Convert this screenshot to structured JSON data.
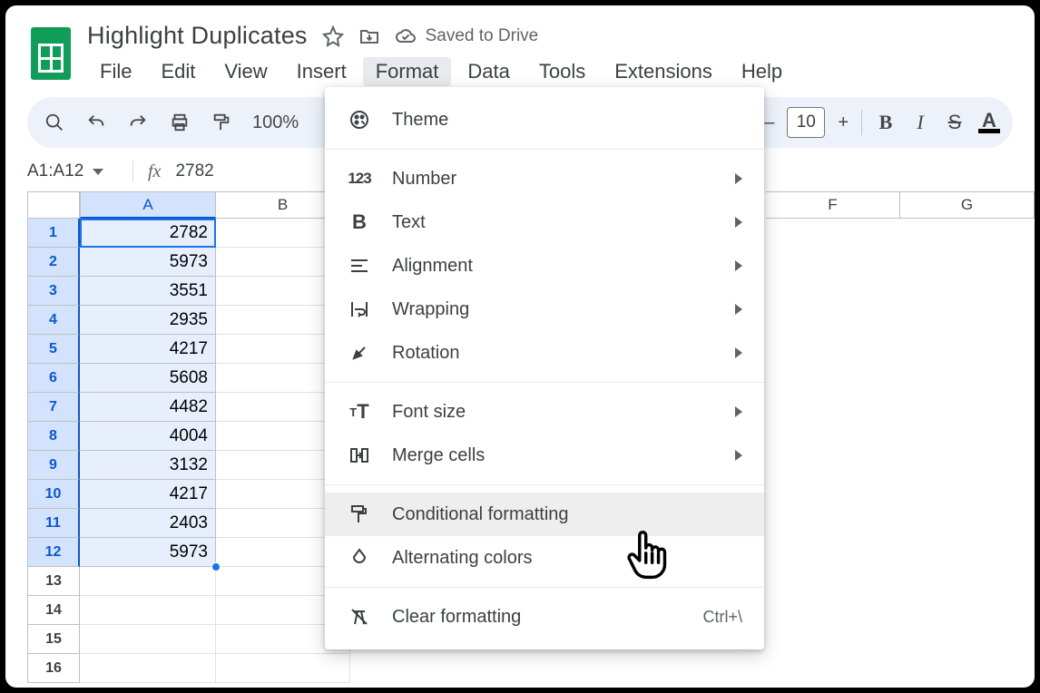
{
  "doc": {
    "title": "Highlight Duplicates",
    "saved": "Saved to Drive"
  },
  "menubar": [
    "File",
    "Edit",
    "View",
    "Insert",
    "Format",
    "Data",
    "Tools",
    "Extensions",
    "Help"
  ],
  "menubar_open_index": 4,
  "toolbar": {
    "zoom": "100%",
    "fontsize": "10",
    "minus": "–",
    "plus": "+"
  },
  "namebox": {
    "range": "A1:A12",
    "formula_value": "2782"
  },
  "columns": [
    "A",
    "B",
    "F",
    "G"
  ],
  "col_widths": {
    "A": 150,
    "B": 148,
    "F": 148,
    "G": 148
  },
  "rows_visible": 16,
  "selection": {
    "col": "A",
    "row_start": 1,
    "row_end": 12
  },
  "data_colA": [
    "2782",
    "5973",
    "3551",
    "2935",
    "4217",
    "5608",
    "4482",
    "4004",
    "3132",
    "4217",
    "2403",
    "5973"
  ],
  "format_menu": {
    "groups": [
      [
        {
          "icon": "theme",
          "label": "Theme",
          "submenu": false
        }
      ],
      [
        {
          "icon": "number",
          "label": "Number",
          "submenu": true
        },
        {
          "icon": "text",
          "label": "Text",
          "submenu": true
        },
        {
          "icon": "align",
          "label": "Alignment",
          "submenu": true
        },
        {
          "icon": "wrap",
          "label": "Wrapping",
          "submenu": true
        },
        {
          "icon": "rotate",
          "label": "Rotation",
          "submenu": true
        }
      ],
      [
        {
          "icon": "fontsize",
          "label": "Font size",
          "submenu": true
        },
        {
          "icon": "merge",
          "label": "Merge cells",
          "submenu": true
        }
      ],
      [
        {
          "icon": "condfmt",
          "label": "Conditional formatting",
          "submenu": false,
          "hovered": true
        },
        {
          "icon": "altcolors",
          "label": "Alternating colors",
          "submenu": false
        }
      ],
      [
        {
          "icon": "clearfmt",
          "label": "Clear formatting",
          "submenu": false,
          "shortcut": "Ctrl+\\"
        }
      ]
    ]
  }
}
